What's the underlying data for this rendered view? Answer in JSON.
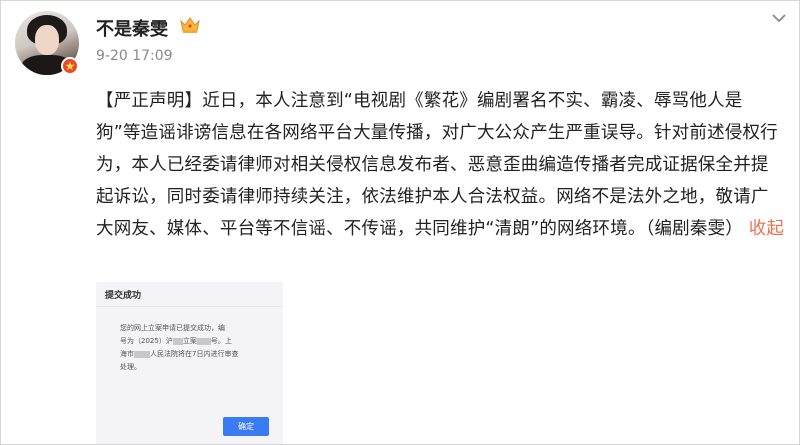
{
  "user": {
    "name": "不是秦雯",
    "timestamp": "9-20 17:09"
  },
  "post": {
    "text": "【严正声明】近日，本人注意到“电视剧《繁花》编剧署名不实、霸凌、辱骂他人是狗”等造谣诽谤信息在各网络平台大量传播，对广大公众产生严重误导。针对前述侵权行为，本人已经委请律师对相关侵权信息发布者、恶意歪曲编造传播者完成证据保全并提起诉讼，同时委请律师持续关注，依法维护本人合法权益。网络不是法外之地，敬请广大网友、媒体、平台等不信谣、不传谣，共同维护“清朗”的网络环境。（编剧秦雯）",
    "collapse_label": "收起"
  },
  "attachment": {
    "title": "提交成功",
    "line1": "您的网上立案申请已提交成功，编",
    "line2_a": "号为（2025）沪",
    "line2_b": "立案",
    "line2_c": "号。上",
    "line3_a": "海市",
    "line3_b": "人民法院将在7日内进行审查",
    "line4": "处理。",
    "button_label": "确定"
  },
  "colors": {
    "accent": "#eb7350",
    "badge": "#f0442d",
    "button": "#3a7bf2"
  },
  "icons": {
    "verified": "verified-badge-icon",
    "crown": "crown-icon",
    "menu": "chevron-down-icon"
  }
}
